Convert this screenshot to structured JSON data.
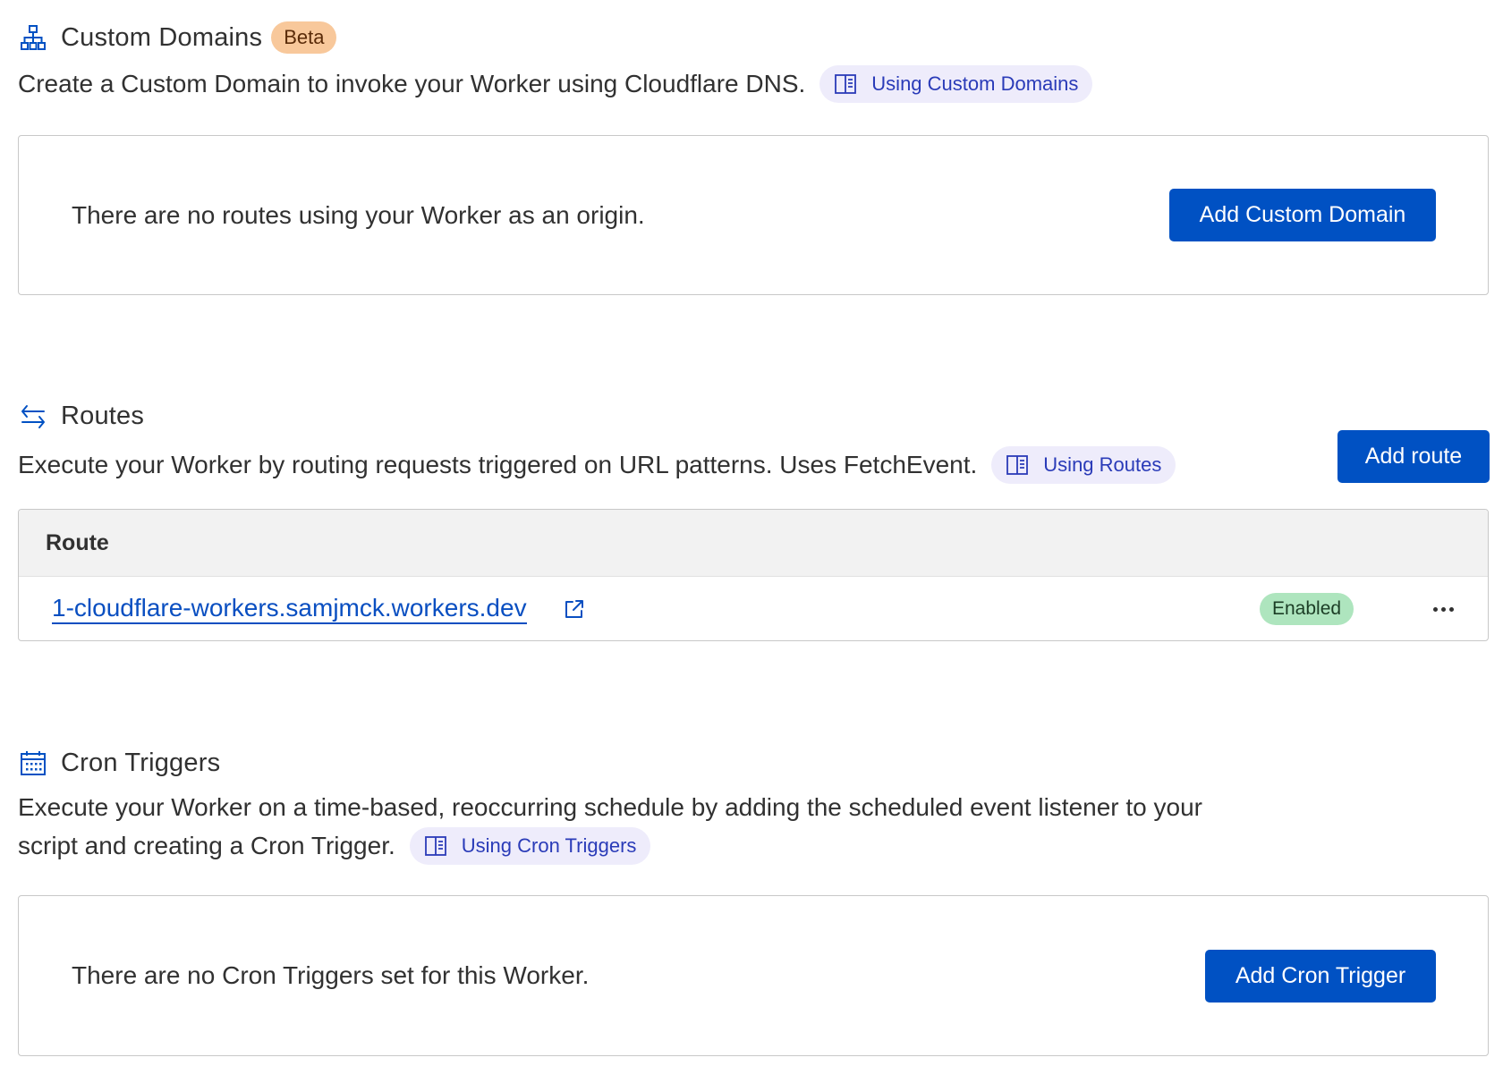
{
  "custom_domains": {
    "title": "Custom Domains",
    "badge": "Beta",
    "description": "Create a Custom Domain to invoke your Worker using Cloudflare DNS.",
    "doc_link": "Using Custom Domains",
    "empty_message": "There are no routes using your Worker as an origin.",
    "add_button": "Add Custom Domain",
    "icon": "sitemap-icon"
  },
  "routes": {
    "title": "Routes",
    "description": "Execute your Worker by routing requests triggered on URL patterns. Uses FetchEvent.",
    "doc_link": "Using Routes",
    "add_button": "Add route",
    "icon": "arrows-exchange-icon",
    "table": {
      "columns": [
        "Route"
      ],
      "rows": [
        {
          "route": "1-cloudflare-workers.samjmck.workers.dev",
          "status": "Enabled"
        }
      ]
    }
  },
  "cron_triggers": {
    "title": "Cron Triggers",
    "description_line1": "Execute your Worker on a time-based, reoccurring schedule by adding the scheduled event listener to your",
    "description_line2": "script and creating a Cron Trigger.",
    "doc_link": "Using Cron Triggers",
    "empty_message": "There are no Cron Triggers set for this Worker.",
    "add_button": "Add Cron Trigger",
    "icon": "calendar-icon"
  },
  "colors": {
    "primary": "#0051c3",
    "link": "#0a4fc1",
    "beta_badge": "#f8c89b",
    "enabled_badge": "#aee5be",
    "doc_chip": "#eeecfb"
  }
}
